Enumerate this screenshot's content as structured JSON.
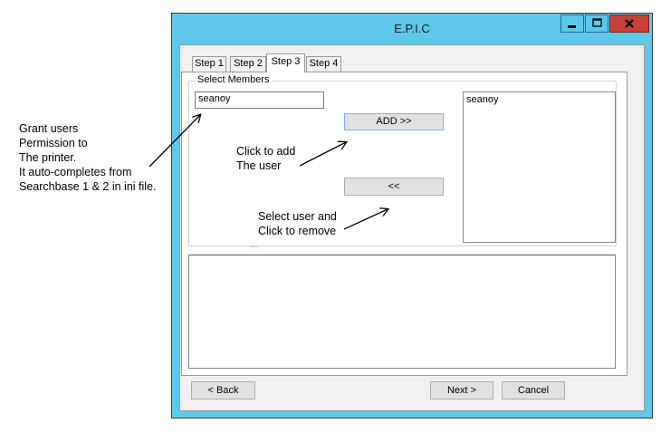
{
  "window": {
    "title": "E.P.I.C"
  },
  "tabs": [
    {
      "label": "Step 1"
    },
    {
      "label": "Step 2"
    },
    {
      "label": "Step 3",
      "selected": true
    },
    {
      "label": "Step 4"
    }
  ],
  "group": {
    "legend": "Select Members",
    "search_value": "seanoy",
    "add_button": "ADD >>",
    "remove_button": "<<",
    "members": [
      "seanoy"
    ]
  },
  "footer": {
    "back_button": "< Back",
    "next_button": "Next >",
    "cancel_button": "Cancel"
  },
  "annotations": {
    "grant": "Grant users\nPermission to\nThe printer.\nIt auto-completes from\nSearchbase 1 & 2 in ini file.",
    "add": "Click to add\nThe user",
    "remove": "Select user and\nClick to remove"
  },
  "colors": {
    "title_bar": "#5ec8ea",
    "close_button": "#c7403a"
  }
}
